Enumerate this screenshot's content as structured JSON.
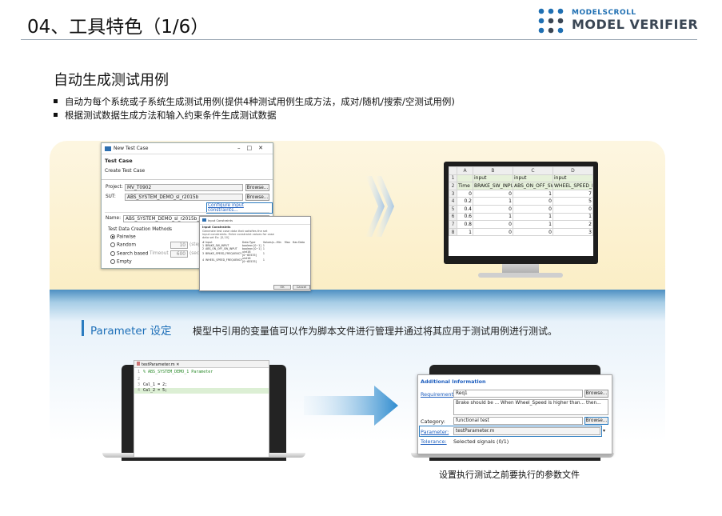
{
  "slide": {
    "title": "04、工具特色（1/6）"
  },
  "logo": {
    "line1": "MODELSCROLL",
    "line2": "MODEL VERIFIER"
  },
  "section": {
    "title": "自动生成测试用例",
    "bullets": [
      "自动为每个系统或子系统生成测试用例(提供4种测试用例生成方法，成对/随机/搜索/空测试用例)",
      "根据测试数据生成方法和输入约束条件生成测试数据"
    ]
  },
  "dialog": {
    "title": "New Test Case",
    "header": "Test Case",
    "header_sub": "Create Test Case",
    "project_label": "Project:",
    "project_value": "MV_T0902",
    "sut_label": "SUT:",
    "sut_value": "ABS_SYSTEM_DEMO_sl_r2015b",
    "browse": "Browse...",
    "configure": "Configure input constraints...",
    "name_label": "Name:",
    "name_value": "ABS_SYSTEM_DEMO_sl_r2015b_1",
    "methods_title": "Test Data Creation Methods",
    "methods": [
      "Pairwise",
      "Random",
      "Search based",
      "Empty"
    ],
    "selected_method": "Pairwise",
    "random_value": "10",
    "random_unit": "(steps)",
    "timeout_label": "Timeout",
    "timeout_value": "600",
    "timeout_unit": "(sec)"
  },
  "constraints": {
    "title": "Input Constraints",
    "heading": "Input Constraints",
    "desc": "Generate test case data that satisfies the set input constraints. Enter constraint values for case data set Ex: [0,10]",
    "columns": [
      "#",
      "Input",
      "Data Type",
      "Values(s...",
      "Min",
      "Max",
      "Has Data"
    ],
    "rows": [
      [
        "1",
        "BRAKE_SW_INPUT",
        "boolean [0~1]",
        "1"
      ],
      [
        "2",
        "ABS_ON_OFF_SW_INPUT",
        "boolean [0~1]",
        "1"
      ],
      [
        "3",
        "BRAKE_SPEED_FREQUENCY",
        "uint16 [0~65535]",
        "1"
      ],
      [
        "4",
        "WHEEL_SPEED_FREQUENCY",
        "uint16 [0~65535]",
        "1"
      ]
    ],
    "ok": "OK",
    "cancel": "Cancel"
  },
  "sheet": {
    "cols": [
      "",
      "A",
      "B",
      "C",
      "D"
    ],
    "rows": [
      [
        "1",
        "",
        "input",
        "input",
        "input"
      ],
      [
        "2",
        "Time",
        "BRAKE_SW_INPUT",
        "ABS_ON_OFF_SW",
        "WHEEL_SPEED_F"
      ],
      [
        "3",
        "0",
        "0",
        "1",
        "7"
      ],
      [
        "4",
        "0.2",
        "1",
        "0",
        "5"
      ],
      [
        "5",
        "0.4",
        "0",
        "0",
        "0"
      ],
      [
        "6",
        "0.6",
        "1",
        "1",
        "1"
      ],
      [
        "7",
        "0.8",
        "0",
        "1",
        "2"
      ],
      [
        "8",
        "1",
        "0",
        "0",
        "3"
      ]
    ]
  },
  "param": {
    "title": "Parameter 设定",
    "desc": "模型中引用的变量值可以作为脚本文件进行管理并通过将其应用于测试用例进行测试。"
  },
  "editor": {
    "tab": "testParameter.m",
    "lines": [
      "% ABS_SYSTEM_DEMO_1 Parameter",
      "",
      "Cal_1 = 2;",
      "Cal_2 = 5;"
    ]
  },
  "addinfo": {
    "title": "Additional Information",
    "req_label": "Requirement:",
    "req_value": "Req1",
    "browse": "Browse...",
    "req_text": "Brake should be ... When Wheel_Speed is higher than... then...",
    "cat_label": "Category:",
    "cat_value": "functional test",
    "param_label": "Parameter:",
    "param_value": "testParameter.m",
    "tol_label": "Tolerance:",
    "tol_value": "Selected signals (0/1)"
  },
  "caption": "设置执行测试之前要执行的参数文件"
}
